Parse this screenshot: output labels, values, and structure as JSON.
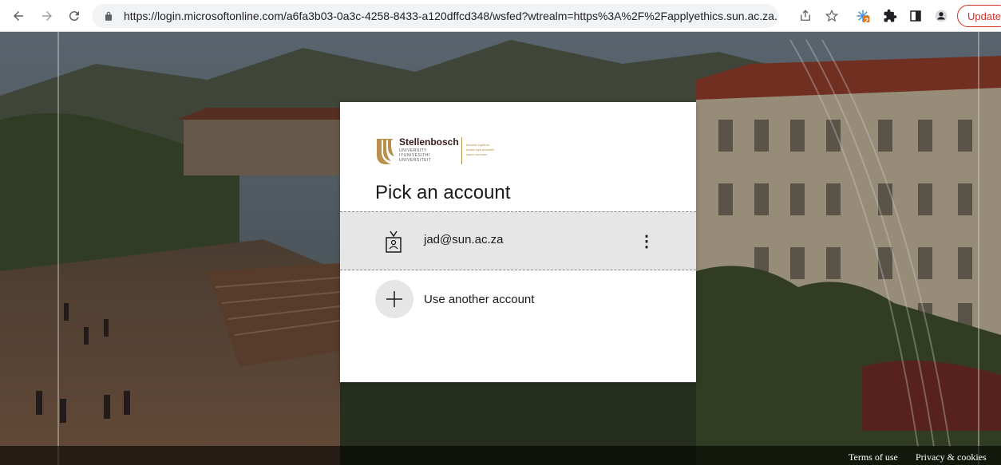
{
  "browser": {
    "url": "https://login.microsoftonline.com/a6fa3b03-0a3c-4258-8433-a120dffcd348/wsfed?wtrealm=https%3A%2F%2Fapplyethics.sun.ac.za...",
    "update_label": "Update",
    "extension_badge": "2"
  },
  "logo": {
    "name": "Stellenbosch",
    "lines": [
      "UNIVERSITY",
      "IYUNIVESITHI",
      "UNIVERSITEIT"
    ],
    "tagline": [
      "forward together",
      "sonke siya phambili",
      "saam vorentoe"
    ]
  },
  "card": {
    "title": "Pick an account",
    "account_email": "jad@sun.ac.za",
    "more_label": "⋮",
    "another_account_label": "Use another account"
  },
  "footer": {
    "terms_label": "Terms of use",
    "privacy_label": "Privacy & cookies"
  },
  "colors": {
    "accent_red": "#d93025",
    "logo_gold": "#b98f4a",
    "card_bg": "#ffffff",
    "selected_row": "#e6e6e6"
  },
  "icons": [
    "back-arrow-icon",
    "forward-arrow-icon",
    "reload-icon",
    "lock-icon",
    "share-icon",
    "star-icon",
    "extension-icon",
    "puzzle-icon",
    "side-panel-icon",
    "profile-icon",
    "badge-icon",
    "plus-icon",
    "more-icon"
  ]
}
